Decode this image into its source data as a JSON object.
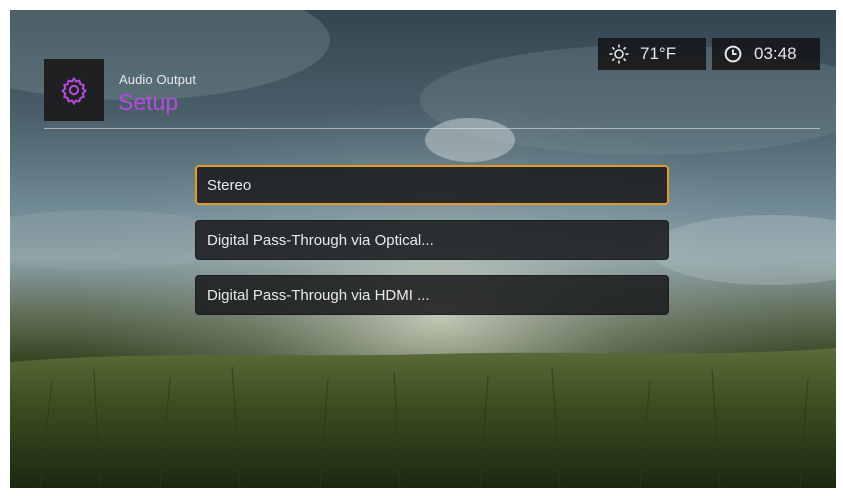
{
  "header": {
    "subtitle": "Audio Output",
    "title": "Setup",
    "icon": "gear-icon",
    "accent_color": "#b44bdc"
  },
  "status": {
    "weather_icon": "sun-icon",
    "temperature": "71°F",
    "clock_icon": "clock-icon",
    "time": "03:48"
  },
  "menu": {
    "items": [
      {
        "label": "Stereo",
        "selected": true
      },
      {
        "label": "Digital Pass-Through via Optical...",
        "selected": false
      },
      {
        "label": "Digital Pass-Through via HDMI ...",
        "selected": false
      }
    ],
    "highlight_color": "#e39a2a"
  }
}
